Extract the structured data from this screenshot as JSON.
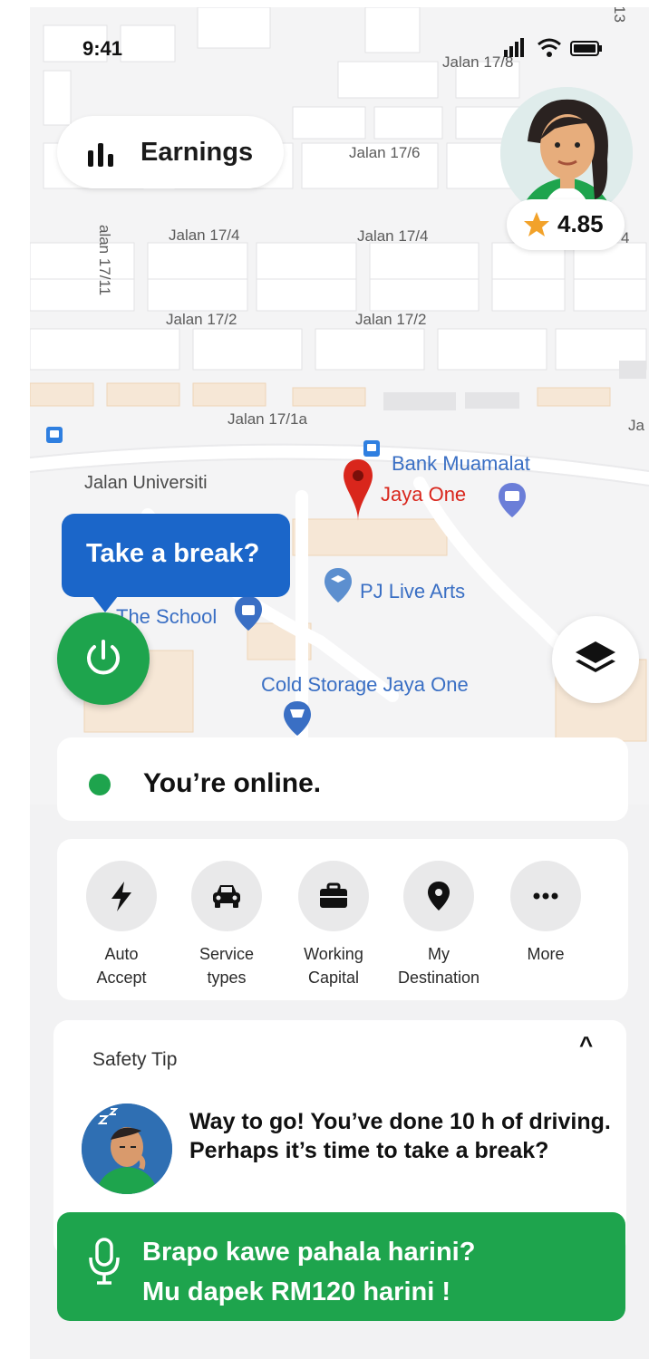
{
  "status_bar": {
    "time": "9:41"
  },
  "header": {
    "earnings_label": "Earnings",
    "rating": "4.85"
  },
  "map": {
    "street_labels": [
      "Jalan 17/8",
      "Jalan 17/6",
      "Jalan 17/4",
      "Jalan 17/4",
      "alan 17/11",
      "Jalan 17/2",
      "Jalan 17/2",
      "Jalan 17/1a",
      "Jalan Universiti",
      "Ja",
      "4",
      "13"
    ],
    "pois": {
      "bank": "Bank Muamalat",
      "destination": "Jaya One",
      "school": "The School",
      "arts": "PJ Live Arts",
      "store": "Cold Storage Jaya One"
    }
  },
  "break_prompt": "Take a break?",
  "online_status": "You’re online.",
  "quick_actions": [
    {
      "line1": "Auto",
      "line2": "Accept",
      "icon": "bolt-icon"
    },
    {
      "line1": "Service",
      "line2": "types",
      "icon": "car-icon"
    },
    {
      "line1": "Working",
      "line2": "Capital",
      "icon": "briefcase-icon"
    },
    {
      "line1": "My",
      "line2": "Destination",
      "icon": "pin-icon"
    },
    {
      "line1": "More",
      "line2": "",
      "icon": "more-icon"
    }
  ],
  "safety_tip": {
    "title": "Safety Tip",
    "collapse_symbol": "^",
    "message": "Way to go! You’ve done 10 h of driving. Perhaps it’s time to take a break?"
  },
  "voice_banner": {
    "line1": "Brapo kawe pahala harini?",
    "line2": "Mu dapek RM120 harini !"
  },
  "colors": {
    "online_green": "#1ea44d",
    "tooltip_blue": "#1b66c9",
    "pin_red": "#d9261c",
    "poi_blue": "#3a6fc4"
  }
}
